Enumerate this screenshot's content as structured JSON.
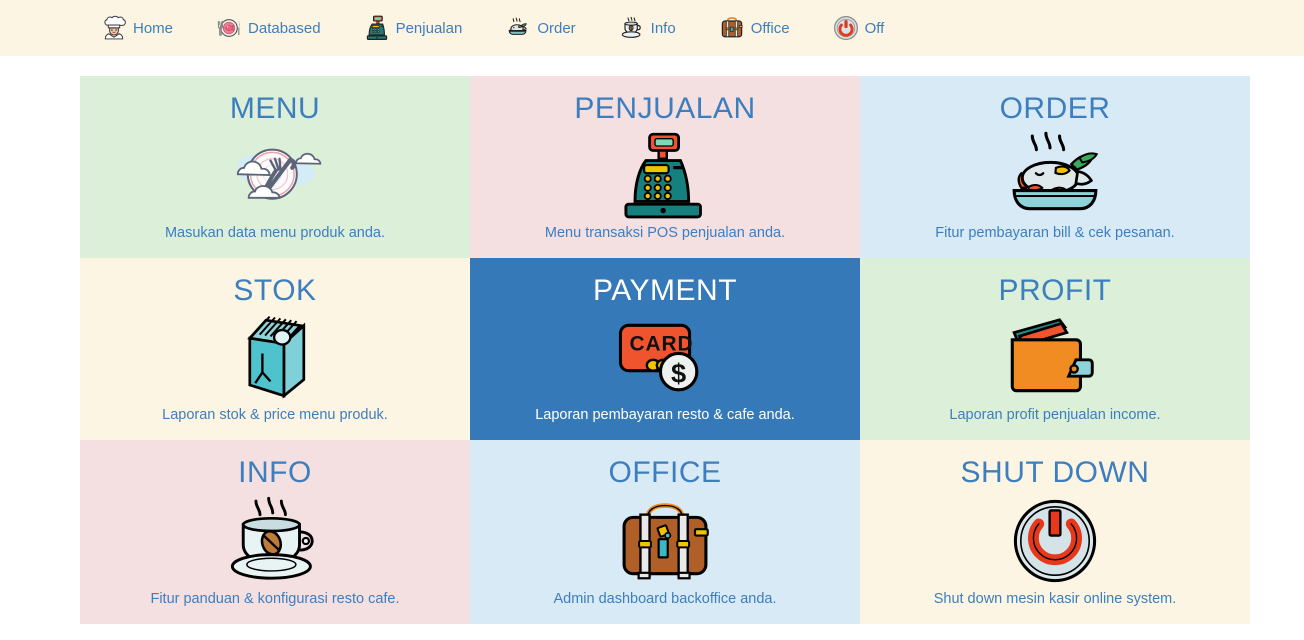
{
  "nav": {
    "items": [
      {
        "label": "Home",
        "icon": "chef-icon"
      },
      {
        "label": "Databased",
        "icon": "plate-cutlery-icon"
      },
      {
        "label": "Penjualan",
        "icon": "cash-register-icon"
      },
      {
        "label": "Order",
        "icon": "fish-dish-icon"
      },
      {
        "label": "Info",
        "icon": "coffee-cup-icon"
      },
      {
        "label": "Office",
        "icon": "briefcase-icon"
      },
      {
        "label": "Off",
        "icon": "power-icon"
      }
    ]
  },
  "grid": {
    "tiles": [
      {
        "title": "MENU",
        "desc": "Masukan data menu produk anda.",
        "icon": "plate-fork-knife-clouds-icon",
        "bg": "#dcefd8",
        "active": false
      },
      {
        "title": "PENJUALAN",
        "desc": "Menu transaksi POS penjualan anda.",
        "icon": "cash-register-icon",
        "bg": "#f4dfe1",
        "active": false
      },
      {
        "title": "ORDER",
        "desc": "Fitur pembayaran bill & cek pesanan.",
        "icon": "fish-dish-icon",
        "bg": "#d9eaf7",
        "active": false
      },
      {
        "title": "STOK",
        "desc": "Laporan stok & price menu produk.",
        "icon": "milk-carton-icon",
        "bg": "#fdf5e3",
        "active": false
      },
      {
        "title": "PAYMENT",
        "desc": "Laporan pembayaran resto & cafe anda.",
        "icon": "credit-card-coins-icon",
        "bg": "#3579b9",
        "active": true
      },
      {
        "title": "PROFIT",
        "desc": "Laporan profit penjualan income.",
        "icon": "wallet-icon",
        "bg": "#dcefd8",
        "active": false
      },
      {
        "title": "INFO",
        "desc": "Fitur panduan & konfigurasi resto cafe.",
        "icon": "coffee-cup-icon",
        "bg": "#f4dfe1",
        "active": false
      },
      {
        "title": "OFFICE",
        "desc": "Admin dashboard backoffice anda.",
        "icon": "briefcase-icon",
        "bg": "#d9eaf7",
        "active": false
      },
      {
        "title": "SHUT DOWN",
        "desc": "Shut down mesin kasir online system.",
        "icon": "power-button-icon",
        "bg": "#fdf5e3",
        "active": false
      }
    ]
  },
  "colors": {
    "accent_blue": "#3d7ebf",
    "active_blue": "#3579b9",
    "header_cream": "#fdf5e3"
  }
}
